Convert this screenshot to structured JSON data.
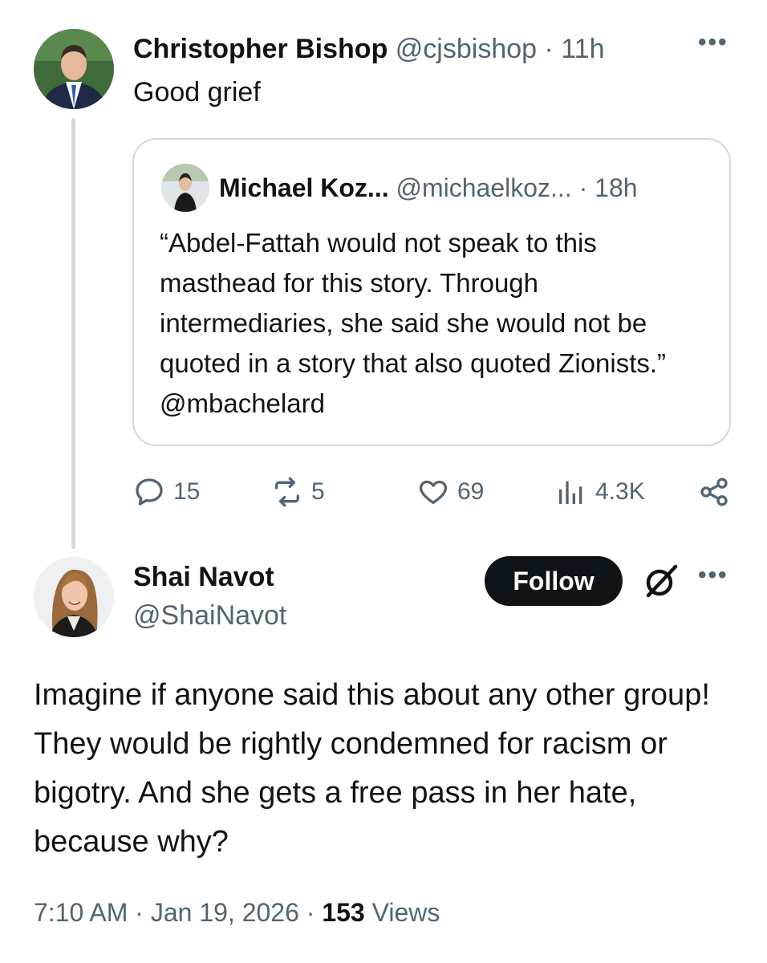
{
  "parent_tweet": {
    "author_name": "Christopher Bishop",
    "handle": "@cjsbishop",
    "separator": "·",
    "time": "11h",
    "more": "•••",
    "text": "Good grief",
    "quote": {
      "author_name": "Michael Koz...",
      "handle": "@michaelkoz...",
      "separator": "·",
      "time": "18h",
      "text": "“Abdel-Fattah would not speak to this masthead for this story. Through intermediaries, she said she would not be quoted in a story that also quoted Zionists.” @mbachelard"
    },
    "actions": {
      "replies": "15",
      "reposts": "5",
      "likes": "69",
      "views": "4.3K"
    }
  },
  "reply_tweet": {
    "author_name": "Shai Navot",
    "handle": "@ShaiNavot",
    "follow_label": "Follow",
    "more": "•••",
    "text": "Imagine if anyone said this about any other group! They would be rightly condemned for racism or bigotry. And she gets a free pass in her hate, because why?",
    "time": "7:10 AM",
    "separator": "·",
    "date": "Jan 19, 2026",
    "views_count": "153",
    "views_label": "Views"
  },
  "icons": {
    "reply": "comment-icon",
    "repost": "repost-icon",
    "like": "heart-icon",
    "views": "analytics-icon",
    "share": "share-icon",
    "grok": "grok-icon"
  },
  "colors": {
    "text": "#0f1419",
    "muted": "#536471",
    "border": "#cfd9de",
    "follow_bg": "#0f1419"
  }
}
